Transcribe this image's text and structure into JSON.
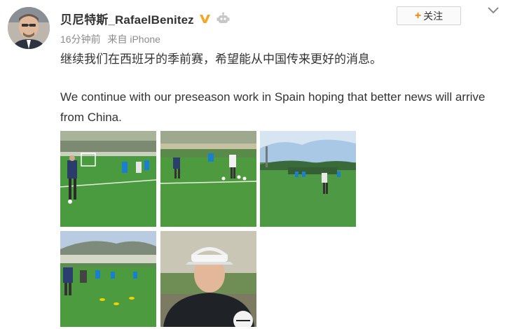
{
  "post": {
    "username": "贝尼特斯_RafaelBenitez",
    "timestamp": "16分钟前",
    "source": "来自 iPhone",
    "text_cn": "继续我们在西班牙的季前赛，希望能从中国传来更好的消息。",
    "text_en": "We continue with our preseason work in Spain hoping that better news will arrive from China."
  },
  "actions": {
    "follow_label": "关注"
  },
  "icons": {
    "verified": "verified-v-badge-icon",
    "member": "robot-member-icon",
    "menu": "chevron-down-icon"
  },
  "colors": {
    "verified": "#f5a623",
    "follow_plus": "#ff8200",
    "meta_text": "#8b8b8b"
  }
}
